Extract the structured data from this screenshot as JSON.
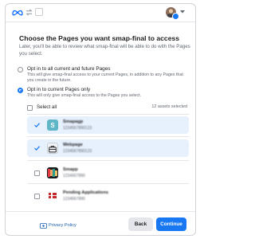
{
  "header": {
    "icons": [
      "meta-logo",
      "sync-arrows",
      "app-badge",
      "user-avatar",
      "chevron-down"
    ]
  },
  "dialog": {
    "title": "Choose the Pages you want smap-final to access",
    "subtitle": "Later, you'll be able to review what smap-final will be able to do with the Pages you select."
  },
  "options": [
    {
      "label": "Opt in to all current and future Pages",
      "description": "This will give smap-final access to your current Pages, in addition to any Pages that you create in the future.",
      "checked": false
    },
    {
      "label": "Opt in to current Pages only",
      "description": "This will only give smap-final access to the Pages you select.",
      "checked": true
    }
  ],
  "selection": {
    "select_all_label": "Select all",
    "count_text": "12 assets selected"
  },
  "pages": [
    {
      "name": "Smapagp",
      "sub": "1234567890123",
      "selected": true,
      "thumb": "teal-letter-s"
    },
    {
      "name": "Webpage",
      "sub": "1234567890123",
      "selected": true,
      "thumb": "briefcase-icon"
    },
    {
      "name": "Smapp",
      "sub": "1234567890",
      "selected": false,
      "thumb": "colorful-logo"
    },
    {
      "name": "Pending Applications",
      "sub": "1234567890",
      "selected": false,
      "thumb": "red-flag"
    }
  ],
  "footer": {
    "policy_link": "Privacy Policy",
    "back_label": "Back",
    "continue_label": "Continue"
  },
  "colors": {
    "accent": "#1877f2",
    "selected_row": "#e7f0fd",
    "link": "#1a5fb4"
  }
}
